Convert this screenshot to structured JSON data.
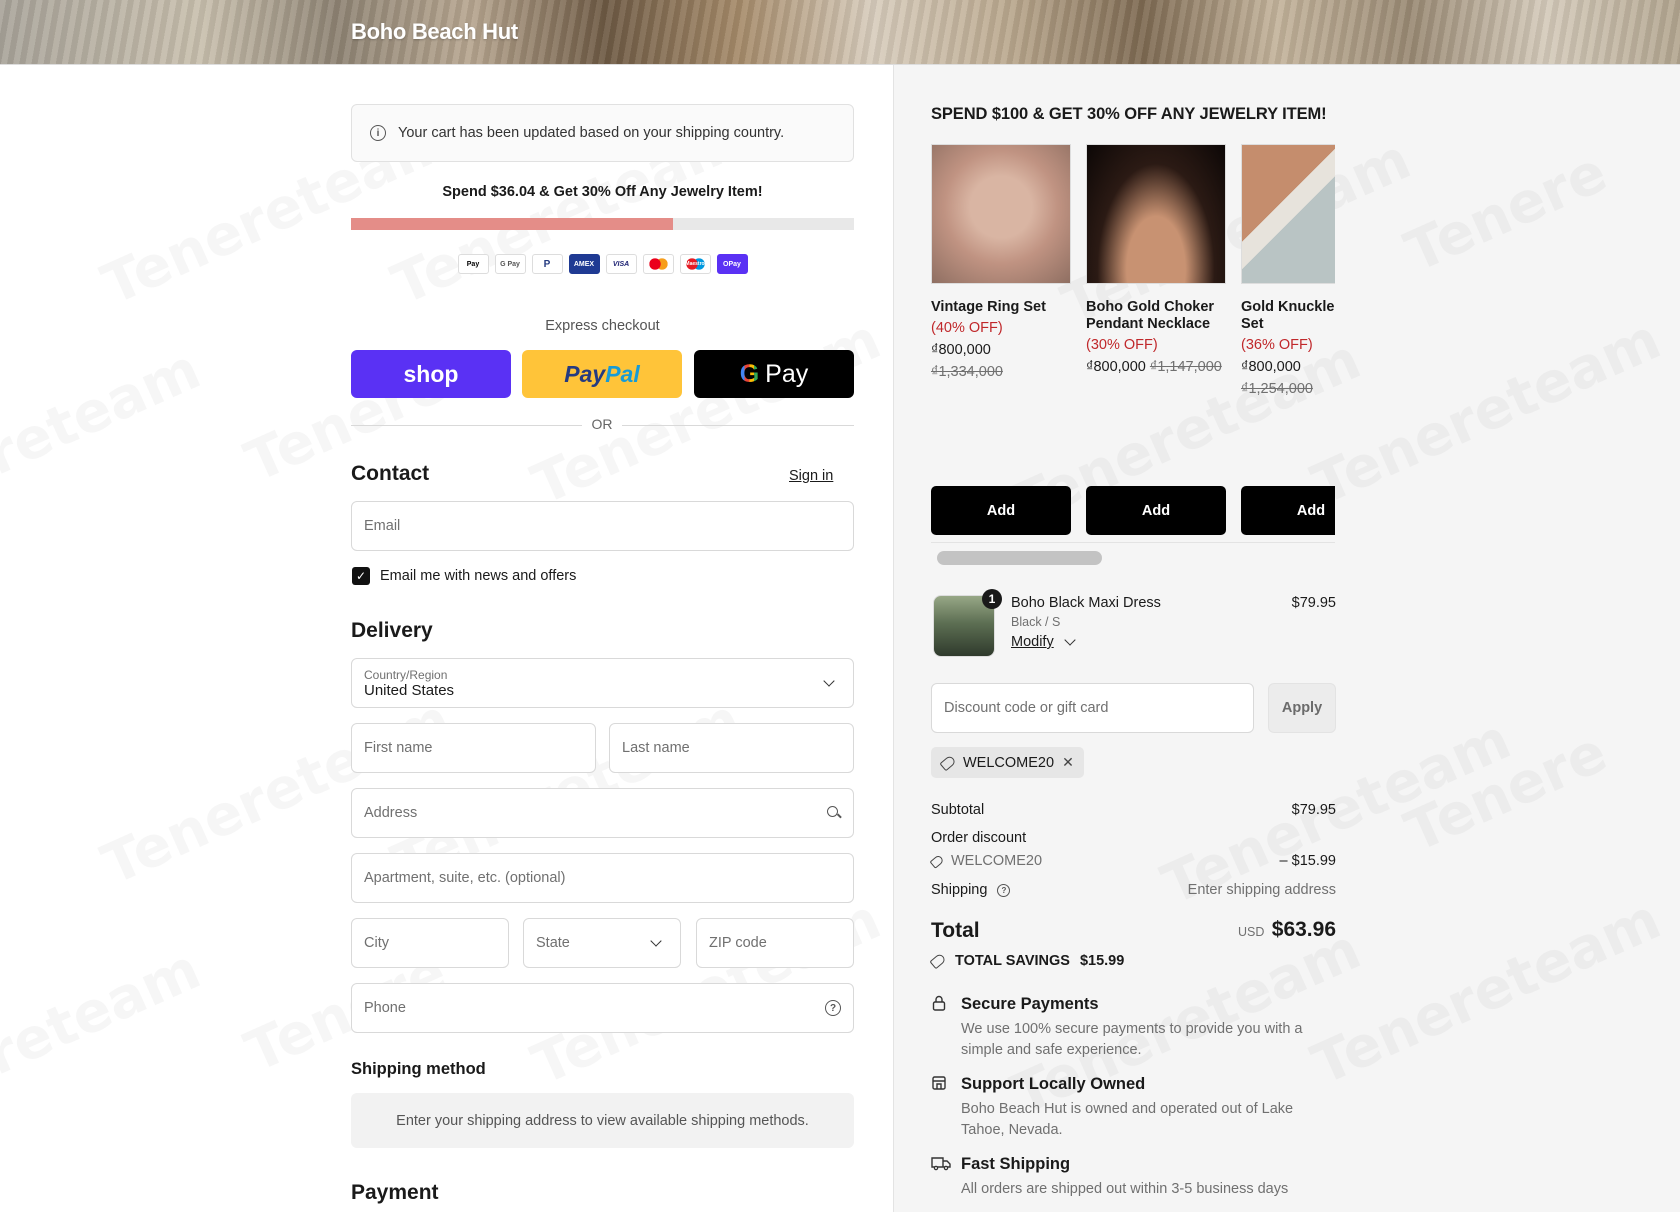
{
  "header": {
    "brand": "Boho Beach Hut"
  },
  "notice": {
    "text": "Your cart has been updated based on your shipping country."
  },
  "promo": {
    "text": "Spend $36.04 & Get 30% Off Any Jewelry Item!",
    "progress": 0.64
  },
  "payment_icons": [
    {
      "name": "apple-pay-icon",
      "label": "Pay"
    },
    {
      "name": "google-pay-icon",
      "label": "G Pay"
    },
    {
      "name": "paypal-icon",
      "label": "P"
    },
    {
      "name": "amex-icon",
      "label": "AMEX"
    },
    {
      "name": "visa-icon",
      "label": "VISA"
    },
    {
      "name": "mastercard-icon",
      "label": ""
    },
    {
      "name": "maestro-icon",
      "label": "Maestro"
    },
    {
      "name": "shop-pay-icon",
      "label": "OPay"
    }
  ],
  "express": {
    "label": "Express checkout",
    "shop": "shop",
    "paypal_a": "Pay",
    "paypal_b": "Pal",
    "gpay_g": "G",
    "gpay_text": "Pay"
  },
  "or_text": "OR",
  "contact": {
    "title": "Contact",
    "sign_in": "Sign in",
    "email_placeholder": "Email",
    "newsletter_label": "Email me with news and offers"
  },
  "delivery": {
    "title": "Delivery",
    "country_label": "Country/Region",
    "country_value": "United States",
    "first_name": "First name",
    "last_name": "Last name",
    "address": "Address",
    "apartment": "Apartment, suite, etc. (optional)",
    "city": "City",
    "state": "State",
    "zip": "ZIP code",
    "phone": "Phone"
  },
  "shipping_method": {
    "title": "Shipping method",
    "note": "Enter your shipping address to view available shipping methods."
  },
  "payment": {
    "title": "Payment"
  },
  "upsell": {
    "title": "SPEND $100 & GET 30% OFF ANY JEWELRY ITEM!",
    "items": [
      {
        "name": "Vintage Ring Set",
        "off": "(40% OFF)",
        "price": "₫800,000",
        "orig": "₫1,334,000",
        "add": "Add"
      },
      {
        "name": "Boho Gold Choker Pendant Necklace",
        "off": "(30% OFF)",
        "price": "₫800,000",
        "orig": "₫1,147,000",
        "add": "Add"
      },
      {
        "name": "Gold Knuckle Ring Set",
        "off": "(36% OFF)",
        "price": "₫800,000",
        "orig": "₫1,254,000",
        "add": "Add"
      }
    ]
  },
  "cart_item": {
    "qty": "1",
    "name": "Boho Black Maxi Dress",
    "variant": "Black / S",
    "modify": "Modify",
    "price": "$79.95"
  },
  "discount": {
    "placeholder": "Discount code or gift card",
    "apply": "Apply",
    "code": "WELCOME20",
    "remove": "✕"
  },
  "summary": {
    "subtotal_label": "Subtotal",
    "subtotal_value": "$79.95",
    "order_discount_label": "Order discount",
    "discount_code": "WELCOME20",
    "discount_value": "– $15.99",
    "shipping_label": "Shipping",
    "shipping_value": "Enter shipping address",
    "total_label": "Total",
    "currency": "USD",
    "total_value": "$63.96",
    "savings_label": "TOTAL SAVINGS",
    "savings_value": "$15.99"
  },
  "trust": [
    {
      "title": "Secure Payments",
      "desc": "We use 100% secure payments to provide you with a simple and safe experience."
    },
    {
      "title": "Support Locally Owned",
      "desc": "Boho Beach Hut is owned and operated out of Lake Tahoe, Nevada."
    },
    {
      "title": "Fast Shipping",
      "desc": "All orders are shipped out within 3-5 business days"
    }
  ],
  "colors": {
    "accent": "#5a31f4",
    "progress": "#e48d88",
    "sale": "#c0282b"
  }
}
